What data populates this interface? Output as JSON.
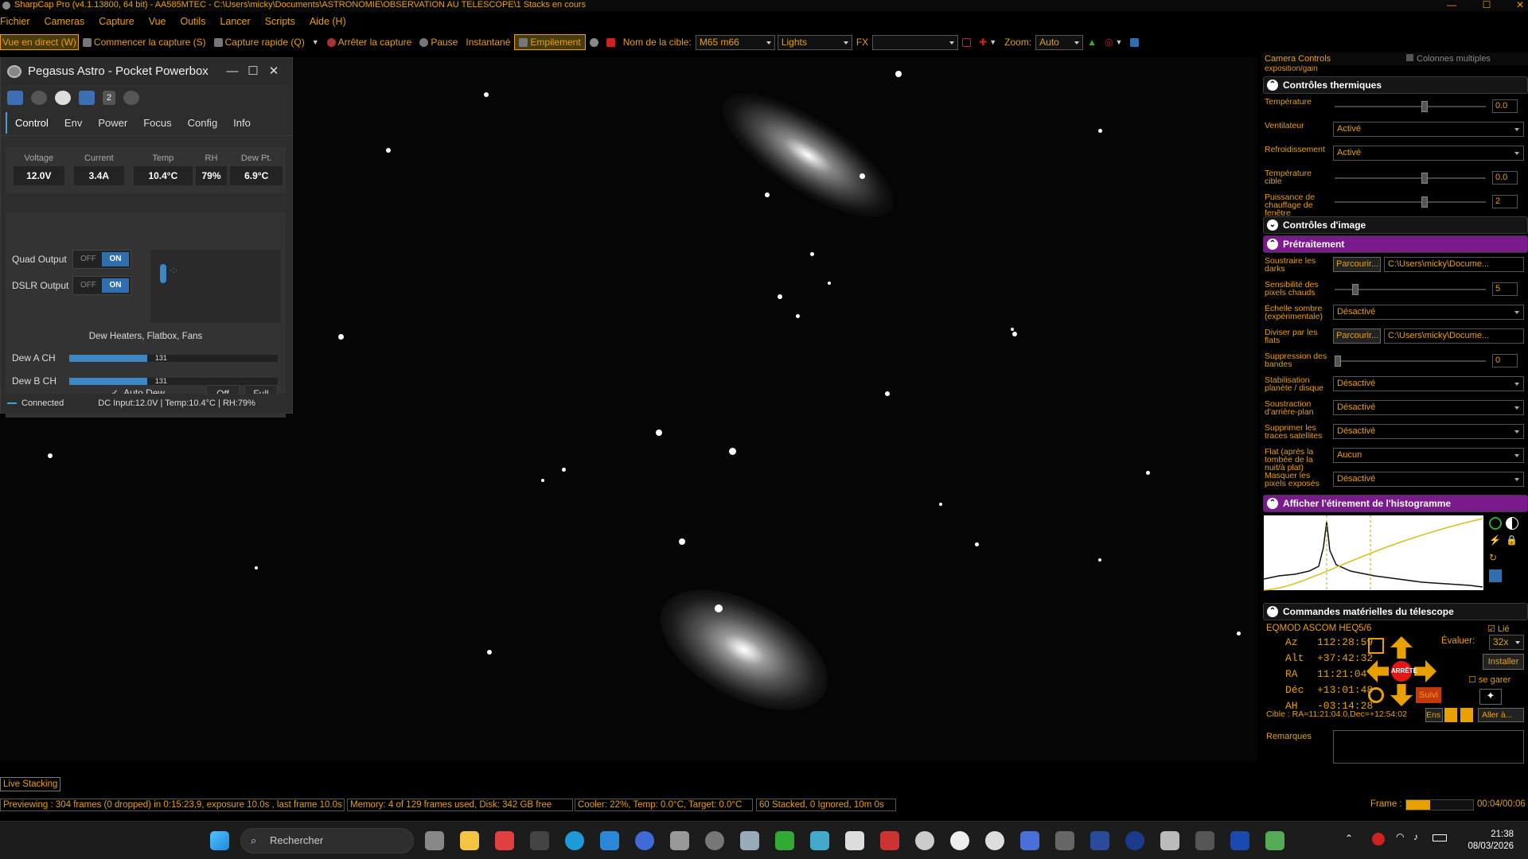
{
  "window": {
    "title": "SharpCap Pro (v4.1.13800, 64 bit) - AA585MTEC - C:\\Users\\micky\\Documents\\ASTRONOMIE\\OBSERVATION AU TELESCOPE\\1 Stacks en cours"
  },
  "menu": [
    "Fichier",
    "Cameras",
    "Capture",
    "Vue",
    "Outils",
    "Lancer",
    "Scripts",
    "Aide (H)"
  ],
  "toolbar": {
    "live_view": "Vue en direct (W)",
    "start_capture": "Commencer la capture (S)",
    "quick_capture": "Capture rapide (Q)",
    "stop_capture": "Arrêter la capture",
    "pause": "Pause",
    "snapshot": "Instantané",
    "stacking": "Empilement",
    "target_label": "Nom de la cible:",
    "target_value": "M65 m66",
    "frame_type": "Lights",
    "fx_label": "FX",
    "fx_value": "",
    "zoom_label": "Zoom:",
    "zoom_value": "Auto"
  },
  "pegasus": {
    "title": "Pegasus Astro - Pocket Powerbox",
    "badge": "2",
    "tabs": [
      "Control",
      "Env",
      "Power",
      "Focus",
      "Config",
      "Info"
    ],
    "meters": [
      {
        "label": "Voltage",
        "value": "12.0V"
      },
      {
        "label": "Current",
        "value": "3.4A"
      },
      {
        "label": "Temp",
        "value": "10.4°C"
      },
      {
        "label": "RH",
        "value": "79%"
      },
      {
        "label": "Dew Pt.",
        "value": "6.9°C"
      }
    ],
    "quad_output": "Quad Output",
    "dslr_output": "DSLR Output",
    "off": "OFF",
    "on": "ON",
    "dew_title": "Dew Heaters, Flatbox, Fans",
    "dew_a": {
      "label": "Dew A CH",
      "value": "131",
      "level": 0.51
    },
    "dew_b": {
      "label": "Dew B CH",
      "value": "131",
      "level": 0.51
    },
    "auto_dew": "Auto Dew",
    "off_btn": "Off",
    "full_btn": "Full",
    "connected": "Connected",
    "status": "DC Input:12.0V | Temp:10.4°C | RH:79%"
  },
  "right_panel": {
    "header": "Camera Controls",
    "multi_col": "Colonnes multiples",
    "exposure_cut": "exposition/gain",
    "thermal_title": "Contrôles thermiques",
    "thermal": [
      {
        "label": "Température",
        "type": "slider",
        "value": "0.0",
        "level": 0.6
      },
      {
        "label": "Ventilateur",
        "type": "dd",
        "value": "Activé"
      },
      {
        "label": "Refroidissement",
        "type": "dd",
        "value": "Activé"
      },
      {
        "label": "Température cible",
        "type": "slider",
        "value": "0.0",
        "level": 0.6
      },
      {
        "label": "Puissance de chauffage de fenêtre",
        "type": "slider",
        "value": "2",
        "level": 0.6
      }
    ],
    "image_title": "Contrôles d'image",
    "pre_title": "Prétraitement",
    "pre": [
      {
        "label": "Soustraire les darks",
        "type": "path",
        "btn": "Parcourir...",
        "value": "C:\\Users\\micky\\Docume..."
      },
      {
        "label": "Sensibilité des pixels chauds",
        "type": "slider",
        "value": "5",
        "level": 0.12
      },
      {
        "label": "Échelle sombre (expérimentale)",
        "type": "dd",
        "value": "Désactivé"
      },
      {
        "label": "Diviser par les flats",
        "type": "path",
        "btn": "Parcourir...",
        "value": "C:\\Users\\micky\\Docume..."
      },
      {
        "label": "Suppression des bandes",
        "type": "slider",
        "value": "0",
        "level": 0.0
      },
      {
        "label": "Stabilisation planète / disque",
        "type": "dd",
        "value": "Désactivé"
      },
      {
        "label": "Soustraction d'arrière-plan",
        "type": "dd",
        "value": "Désactivé"
      },
      {
        "label": "Supprimer les traces satellites",
        "type": "dd",
        "value": "Désactivé"
      },
      {
        "label": "Flat (après la tombée de la nuit/à plat)",
        "type": "dd",
        "value": "Aucun"
      },
      {
        "label": "Masquer les pixels exposés",
        "type": "dd",
        "value": "Désactivé"
      }
    ],
    "hist_title": "Afficher l'étirement de l'histogramme",
    "scope_title": "Commandes matérielles du télescope",
    "mount": "EQMOD ASCOM HEQ5/6",
    "linked": "Lié",
    "coords": [
      {
        "k": "Az",
        "v": "112:28:59"
      },
      {
        "k": "Alt",
        "v": "+37:42:32"
      },
      {
        "k": "RA",
        "v": "11:21:04"
      },
      {
        "k": "Déc",
        "v": "+13:01:48"
      },
      {
        "k": "AH",
        "v": "-03:14:28"
      }
    ],
    "rate_label": "Évaluer:",
    "rate_value": "32x",
    "install": "Installer",
    "park": "se garer",
    "stop": "ARRÊTE",
    "track": "Suivi",
    "target_line": "Cible : RA=11:21:04.0,Dec=+12:54:02",
    "ens": "Ens",
    "goto": "Aller à...",
    "notes": "Remarques"
  },
  "live_stacking": "Live Stacking",
  "statusbar": {
    "preview": "Previewing : 304 frames (0 dropped) in 0:15:23,9, exposure 10.0s , last frame 10.0s",
    "memory": "Memory: 4 of 129 frames used, Disk: 342 GB free",
    "cooler": "Cooler: 22%, Temp: 0.0°C, Target: 0.0°C",
    "stacked": "60 Stacked, 0 Ignored, 10m 0s",
    "frame_label": "Frame :",
    "elapsed": "00:04/00:06"
  },
  "taskbar": {
    "search": "Rechercher",
    "time": "21:38",
    "date": "08/03/2026"
  },
  "colors": {
    "accent": "#e8a000",
    "purple": "#7a1a8c",
    "blue": "#2f6fb0"
  }
}
